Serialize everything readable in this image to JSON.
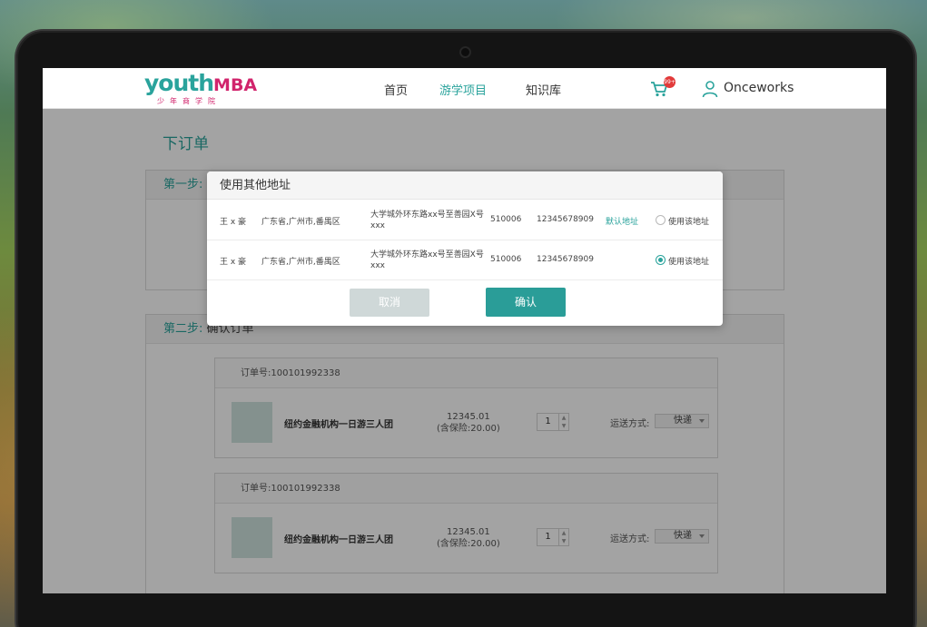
{
  "header": {
    "logo_main": "youth",
    "logo_accent": "MBA",
    "logo_sub": "少年商学院",
    "nav": [
      {
        "label": "首页"
      },
      {
        "label": "游学项目"
      },
      {
        "label": "知识库"
      }
    ],
    "cart_badge": "99+",
    "username": "Onceworks"
  },
  "page": {
    "title": "下订单",
    "step1_label": "第一步:",
    "step2_label": "第二步:",
    "step2_text": "确认订单"
  },
  "orders": [
    {
      "order_no": "订单号:100101992338",
      "product": "纽约金融机构一日游三人团",
      "price": "12345.01",
      "insurance": "(含保险:20.00)",
      "qty": "1",
      "ship_label": "运送方式:",
      "ship_value": "快递"
    },
    {
      "order_no": "订单号:100101992338",
      "product": "纽约金融机构一日游三人团",
      "price": "12345.01",
      "insurance": "(含保险:20.00)",
      "qty": "1",
      "ship_label": "运送方式:",
      "ship_value": "快递"
    }
  ],
  "modal": {
    "title": "使用其他地址",
    "addresses": [
      {
        "name": "王 x 豪",
        "region": "广东省,广州市,番禺区",
        "street": "大学城外环东路xx号至善园X号 xxx",
        "zip": "510006",
        "phone": "12345678909",
        "default_label": "默认地址",
        "use_label": "使用该地址",
        "selected": false
      },
      {
        "name": "王 x 豪",
        "region": "广东省,广州市,番禺区",
        "street": "大学城外环东路xx号至善园X号 xxx",
        "zip": "510006",
        "phone": "12345678909",
        "default_label": "",
        "use_label": "使用该地址",
        "selected": true
      }
    ],
    "cancel_label": "取消",
    "confirm_label": "确认"
  },
  "colors": {
    "accent": "#2aa39c",
    "brand_pink": "#d1246c",
    "confirm": "#2a9d98",
    "cancel_disabled": "#cfd8d8"
  }
}
